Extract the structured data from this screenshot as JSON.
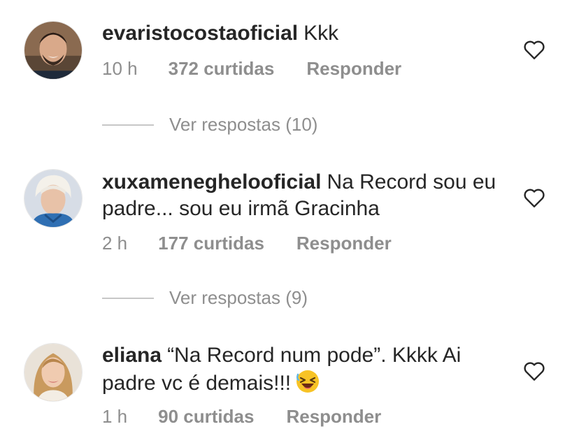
{
  "comments": [
    {
      "username": "evaristocostaoficial",
      "text": "Kkk",
      "time": "10 h",
      "likes": "372 curtidas",
      "reply": "Responder",
      "replies_label": "Ver respostas (10)"
    },
    {
      "username": "xuxameneghelooficial",
      "text": "Na Record sou  eu padre... sou eu irmã Gracinha",
      "time": "2 h",
      "likes": "177 curtidas",
      "reply": "Responder",
      "replies_label": "Ver respostas (9)"
    },
    {
      "username": "eliana",
      "text": "“Na Record num pode”. Kkkk Ai padre vc é demais!!!",
      "time": "1 h",
      "likes": "90 curtidas",
      "reply": "Responder"
    }
  ],
  "icons": {
    "heart": "heart-outline-icon",
    "emoji": "laughing-face-emoji"
  },
  "colors": {
    "primary_text": "#262626",
    "secondary_text": "#8e8e8e",
    "divider": "#c7c7c7",
    "emoji": "#f7c325"
  }
}
